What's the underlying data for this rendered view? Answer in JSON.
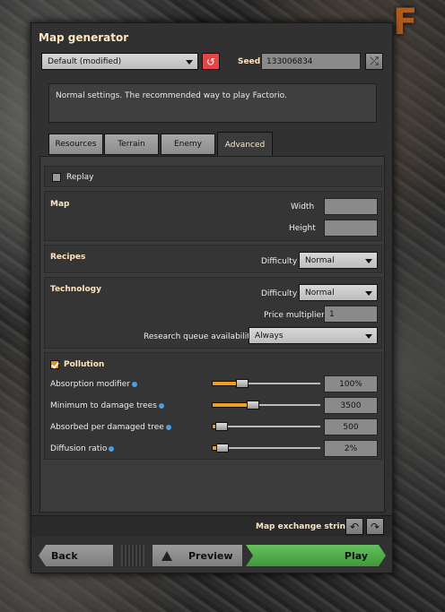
{
  "title": "Map generator",
  "preset": {
    "selected": "Default (modified)"
  },
  "seed": {
    "label": "Seed",
    "value": "133006834"
  },
  "description": "Normal settings. The recommended way to play Factorio.",
  "tabs": [
    {
      "label": "Resources"
    },
    {
      "label": "Terrain"
    },
    {
      "label": "Enemy"
    },
    {
      "label": "Advanced"
    }
  ],
  "advanced": {
    "replay": {
      "label": "Replay",
      "checked": false
    },
    "map": {
      "header": "Map",
      "width_label": "Width",
      "height_label": "Height",
      "width": "",
      "height": ""
    },
    "recipes": {
      "header": "Recipes",
      "difficulty_label": "Difficulty",
      "difficulty": "Normal"
    },
    "technology": {
      "header": "Technology",
      "difficulty_label": "Difficulty",
      "difficulty": "Normal",
      "price_label": "Price multiplier",
      "price": "1",
      "queue_label": "Research queue availability",
      "queue": "Always"
    },
    "pollution": {
      "header": "Pollution",
      "enabled": true,
      "rows": [
        {
          "label": "Absorption modifier",
          "value": "100%",
          "fraction": 0.25
        },
        {
          "label": "Minimum to damage trees",
          "value": "3500",
          "fraction": 0.35
        },
        {
          "label": "Absorbed per damaged tree",
          "value": "500",
          "fraction": 0.06
        },
        {
          "label": "Diffusion ratio",
          "value": "2%",
          "fraction": 0.07
        }
      ]
    }
  },
  "exchange_label": "Map exchange string",
  "buttons": {
    "back": "Back",
    "preview": "Preview",
    "play": "Play"
  },
  "colors": {
    "accent": "#e09020",
    "play": "#5cb755",
    "reset": "#e04848"
  }
}
